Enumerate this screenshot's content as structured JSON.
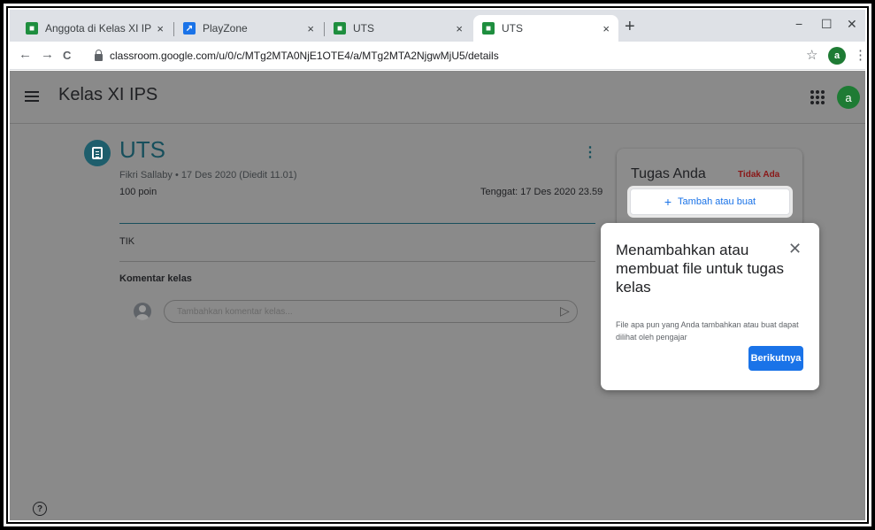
{
  "browser": {
    "tabs": [
      {
        "label": "Anggota di Kelas XI IPS",
        "icon": "classroom-favicon",
        "active": false
      },
      {
        "label": "PlayZone",
        "icon": "playzone-favicon",
        "active": false
      },
      {
        "label": "UTS",
        "icon": "classroom-favicon",
        "active": false
      },
      {
        "label": "UTS",
        "icon": "classroom-favicon",
        "active": true
      }
    ],
    "tab_close": "×",
    "new_tab": "+",
    "window_controls": {
      "minimize": "−",
      "maximize": "☐",
      "close": "✕"
    },
    "nav": {
      "back": "←",
      "forward": "→",
      "reload": "C"
    },
    "url": "classroom.google.com/u/0/c/MTg2MTA0NjE1OTE4/a/MTg2MTA2NjgwMjU5/details",
    "star": "☆",
    "profile_initial": "a",
    "menu": "⋮"
  },
  "app": {
    "class_name": "Kelas XI IPS",
    "avatar_initial": "a"
  },
  "assignment": {
    "title": "UTS",
    "kebab": "⋮",
    "meta": "Fikri Sallaby • 17 Des 2020 (Diedit 11.01)",
    "points": "100 poin",
    "due": "Tenggat: 17 Des 2020 23.59",
    "description": "TIK",
    "comments_heading": "Komentar kelas",
    "comment_placeholder": "Tambahkan komentar kelas...",
    "send_icon": "▷"
  },
  "your_work": {
    "title": "Tugas Anda",
    "status": "Tidak Ada",
    "add_button_plus": "+",
    "add_button_label": "Tambah atau buat"
  },
  "popup": {
    "title": "Menambahkan atau membuat file untuk tugas kelas",
    "close": "✕",
    "body": "File apa pun yang Anda tambahkan atau buat dapat dilihat oleh pengajar",
    "next_button": "Berikutnya"
  },
  "help": "?",
  "colors": {
    "accent": "#1a73e8",
    "teal": "#174f5c",
    "status_missing": "#8a1818",
    "avatar": "#1e7b34"
  }
}
